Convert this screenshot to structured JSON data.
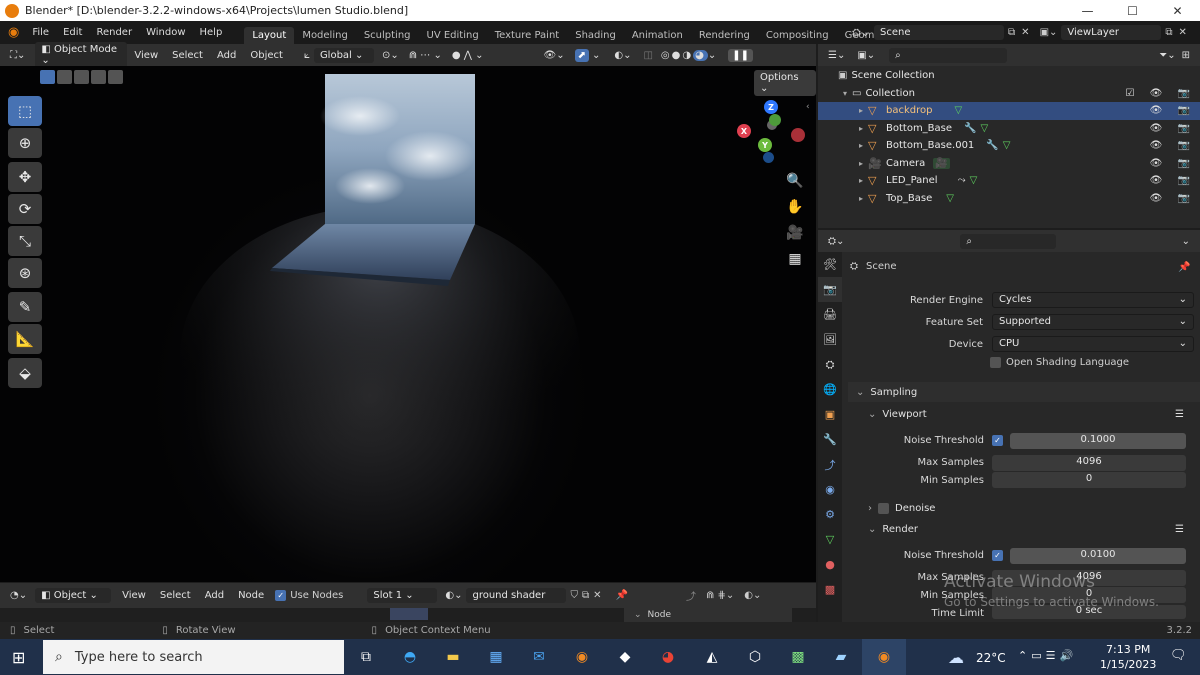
{
  "titlebar": {
    "title": "Blender* [D:\\blender-3.2.2-windows-x64\\Projects\\lumen Studio.blend]",
    "minimize": "—",
    "maximize": "☐",
    "close": "✕"
  },
  "menu": [
    "File",
    "Edit",
    "Render",
    "Window",
    "Help"
  ],
  "workspaces": [
    "Layout",
    "Modeling",
    "Sculpting",
    "UV Editing",
    "Texture Paint",
    "Shading",
    "Animation",
    "Rendering",
    "Compositing",
    "Geometry Noc"
  ],
  "scene": {
    "name": "Scene",
    "viewlayer": "ViewLayer"
  },
  "view3d_header": {
    "mode": "Object Mode",
    "view": "View",
    "select": "Select",
    "add": "Add",
    "object": "Object",
    "orientation": "Global",
    "options": "Options"
  },
  "outliner": {
    "root": "Scene Collection",
    "collection": "Collection",
    "items": [
      {
        "name": "backdrop"
      },
      {
        "name": "Bottom_Base"
      },
      {
        "name": "Bottom_Base.001"
      },
      {
        "name": "Camera"
      },
      {
        "name": "LED_Panel"
      },
      {
        "name": "Top_Base"
      }
    ]
  },
  "properties": {
    "context": "Scene",
    "render_engine_label": "Render Engine",
    "render_engine": "Cycles",
    "feature_set_label": "Feature Set",
    "feature_set": "Supported",
    "device_label": "Device",
    "device": "CPU",
    "osl_label": "Open Shading Language",
    "sampling": "Sampling",
    "viewport": "Viewport",
    "noise_threshold_label": "Noise Threshold",
    "viewport_noise": "0.1000",
    "max_samples_label": "Max Samples",
    "viewport_max": "4096",
    "min_samples_label": "Min Samples",
    "viewport_min": "0",
    "denoise": "Denoise",
    "render": "Render",
    "render_noise": "0.0100",
    "render_max": "4096",
    "render_min": "0",
    "time_limit_label": "Time Limit",
    "time_limit": "0 sec"
  },
  "node_header": {
    "type": "Object",
    "view": "View",
    "select": "Select",
    "add": "Add",
    "node": "Node",
    "use_nodes": "Use Nodes",
    "slot": "Slot 1",
    "material": "ground shader",
    "side_tab": "Node"
  },
  "status": {
    "select": "Select",
    "rotate": "Rotate View",
    "context_menu": "Object Context Menu",
    "version": "3.2.2"
  },
  "watermark": {
    "line1": "Activate Windows",
    "line2": "Go to Settings to activate Windows."
  },
  "taskbar": {
    "search_placeholder": "Type here to search",
    "weather": "22°C",
    "time": "7:13 PM",
    "date": "1/15/2023"
  },
  "gizmo": {
    "x": "X",
    "y": "Y",
    "z": "Z"
  }
}
